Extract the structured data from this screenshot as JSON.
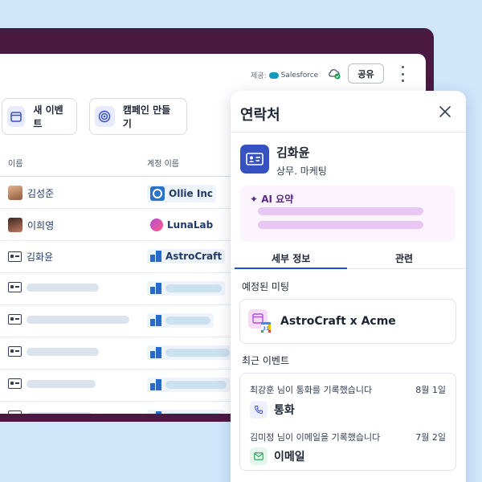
{
  "toolbar": {
    "powered_by_label": "제공:",
    "provider_name": "Salesforce",
    "share_label": "공유"
  },
  "actions": {
    "new_event_label": "새 이벤트",
    "create_campaign_label": "캠페인 만들기"
  },
  "table": {
    "columns": [
      "이름",
      "계정 이름"
    ],
    "rows": [
      {
        "name": "김성준",
        "account": "Ollie Inc"
      },
      {
        "name": "이희영",
        "account": "LunaLab"
      },
      {
        "name": "김화윤",
        "account": "AstroCraft"
      }
    ]
  },
  "panel": {
    "title": "연락처",
    "contact_name": "김화윤",
    "contact_role": "상무. 마케팅",
    "ai_label": "✦ AI 요약",
    "tabs": [
      "세부 정보",
      "관련"
    ],
    "meetings_label": "예정된 미팅",
    "meeting_title": "AstroCraft x Acme",
    "recent_events_label": "최근 이벤트",
    "events": [
      {
        "description": "최강훈 님이 통화를 기록했습니다",
        "date": "8월 1일",
        "type": "통화"
      },
      {
        "description": "김미정 님이 이메일을 기록했습니다",
        "date": "7월 2일",
        "type": "이메일"
      }
    ]
  },
  "colors": {
    "background": "#cfe6fb",
    "window_frame": "#4a1942",
    "accent": "#3551c2",
    "ai_bar": "#e8c7f5"
  }
}
